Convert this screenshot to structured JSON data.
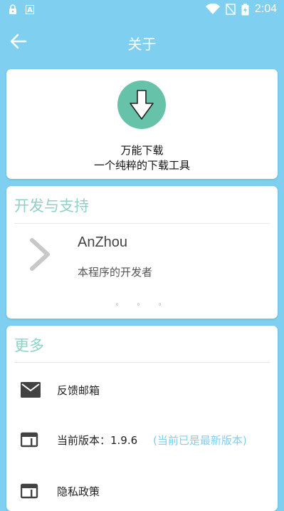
{
  "status_bar": {
    "time": "2:04",
    "a_badge": "A"
  },
  "app_bar": {
    "title": "关于"
  },
  "app_info": {
    "name": "万能下载",
    "description": "一个纯粹的下载工具",
    "logo_color": "#66c3aa"
  },
  "developer_section": {
    "header": "开发与支持",
    "dev_name": "AnZhou",
    "dev_role": "本程序的开发者",
    "pager_dots": "◦ ◦ ◦"
  },
  "more_section": {
    "header": "更多",
    "items": [
      {
        "label": "反馈邮箱",
        "icon": "mail-icon"
      },
      {
        "label": "当前版本：1.9.6",
        "note": "(当前已是最新版本)",
        "icon": "version-icon"
      },
      {
        "label": "隐私政策",
        "icon": "privacy-icon"
      }
    ]
  },
  "colors": {
    "background": "#7fcff0",
    "accent_header": "#8fd0c8"
  }
}
